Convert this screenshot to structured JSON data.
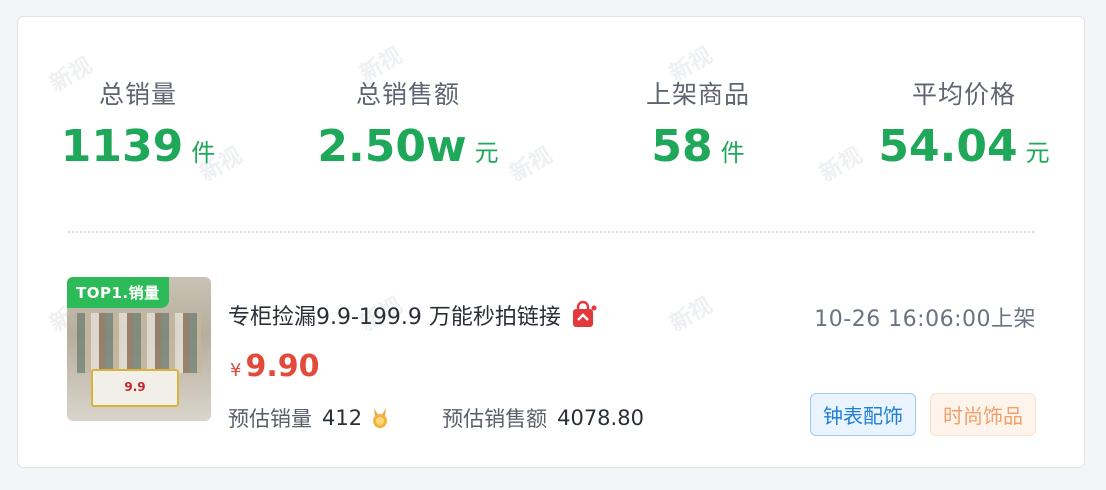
{
  "stats": [
    {
      "label": "总销量",
      "value": "1139",
      "unit": "件"
    },
    {
      "label": "总销售额",
      "value": "2.50w",
      "unit": "元"
    },
    {
      "label": "上架商品",
      "value": "58",
      "unit": "件"
    },
    {
      "label": "平均价格",
      "value": "54.04",
      "unit": "元"
    }
  ],
  "colors": {
    "accent_green": "#1fa75a",
    "price_red": "#e24a3b",
    "tag_blue": "#1f7fd6",
    "tag_orange": "#f0a06a"
  },
  "product": {
    "badge": "TOP1.销量",
    "title": "专柜捡漏9.9-199.9 万能秒拍链接",
    "title_icon": "shopping-bag-icon",
    "listed_time": "10-26 16:06:00上架",
    "price_symbol": "¥",
    "price": "9.90",
    "est_sales_label": "预估销量",
    "est_sales_value": "412",
    "medal_icon": "medal-icon",
    "est_revenue_label": "预估销售额",
    "est_revenue_value": "4078.80",
    "tags": [
      "钟表配饰",
      "时尚饰品"
    ]
  },
  "thumbnail": {
    "sign_text": "9.9"
  }
}
